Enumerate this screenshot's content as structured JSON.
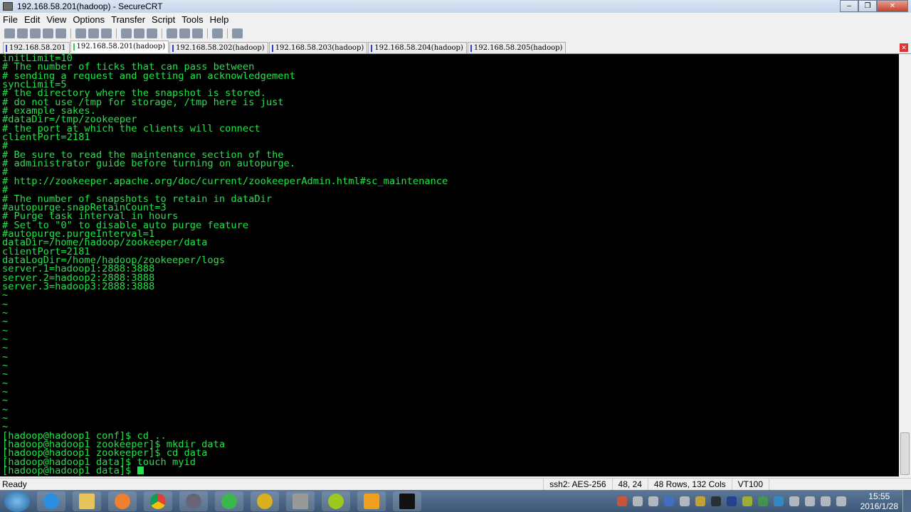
{
  "window": {
    "title": "192.168.58.201(hadoop) - SecureCRT"
  },
  "menu": [
    "File",
    "Edit",
    "View",
    "Options",
    "Transfer",
    "Script",
    "Tools",
    "Help"
  ],
  "tabs": [
    {
      "label": "192.168.58.201",
      "active": false
    },
    {
      "label": "192.168.58.201(hadoop)",
      "active": true
    },
    {
      "label": "192.168.58.202(hadoop)",
      "active": false
    },
    {
      "label": "192.168.58.203(hadoop)",
      "active": false
    },
    {
      "label": "192.168.58.204(hadoop)",
      "active": false
    },
    {
      "label": "192.168.58.205(hadoop)",
      "active": false
    }
  ],
  "terminal": {
    "lines": [
      "initLimit=10",
      "# The number of ticks that can pass between",
      "# sending a request and getting an acknowledgement",
      "syncLimit=5",
      "# the directory where the snapshot is stored.",
      "# do not use /tmp for storage, /tmp here is just",
      "# example sakes.",
      "#dataDir=/tmp/zookeeper",
      "# the port at which the clients will connect",
      "clientPort=2181",
      "#",
      "# Be sure to read the maintenance section of the",
      "# administrator guide before turning on autopurge.",
      "#",
      "# http://zookeeper.apache.org/doc/current/zookeeperAdmin.html#sc_maintenance",
      "#",
      "# The number of snapshots to retain in dataDir",
      "#autopurge.snapRetainCount=3",
      "# Purge task interval in hours",
      "# Set to \"0\" to disable auto purge feature",
      "#autopurge.purgeInterval=1",
      "dataDir=/home/hadoop/zookeeper/data",
      "clientPort=2181",
      "dataLogDir=/home/hadoop/zookeeper/logs",
      "server.1=hadoop1:2888:3888",
      "server.2=hadoop2:2888:3888",
      "server.3=hadoop3:2888:3888",
      "~",
      "~",
      "~",
      "~",
      "~",
      "~",
      "~",
      "~",
      "~",
      "~",
      "~",
      "~",
      "~",
      "~",
      "~",
      "~",
      "[hadoop@hadoop1 conf]$ cd ..",
      "[hadoop@hadoop1 zookeeper]$ mkdir data",
      "[hadoop@hadoop1 zookeeper]$ cd data",
      "[hadoop@hadoop1 data]$ touch myid"
    ],
    "prompt": "[hadoop@hadoop1 data]$ ",
    "text_color": "#22e34a",
    "background": "#000000"
  },
  "status": {
    "ready": "Ready",
    "cipher": "ssh2: AES-256",
    "cursor": "48,  24",
    "size": "48 Rows, 132 Cols",
    "emulation": "VT100"
  },
  "taskbar": {
    "time": "15:55",
    "date": "2016/1/28"
  }
}
